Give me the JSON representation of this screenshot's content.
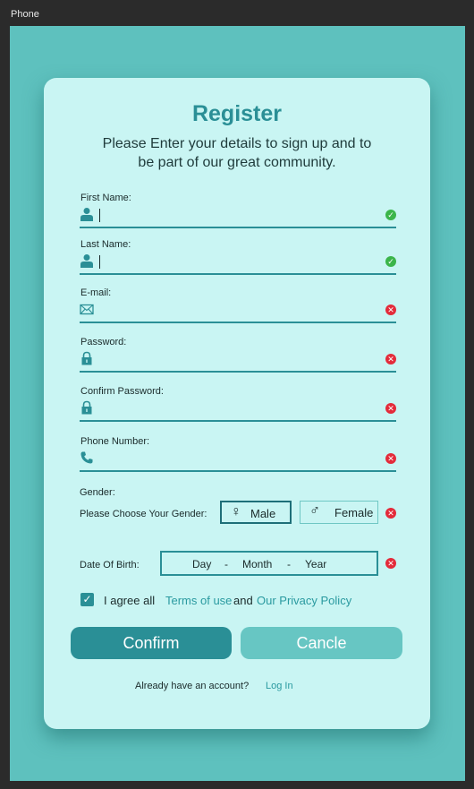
{
  "window": {
    "title": "Phone"
  },
  "colors": {
    "accent": "#2a8f96",
    "background": "#5ec1be",
    "card": "#c9f5f3",
    "valid": "#3bb54a",
    "invalid": "#e32b3a"
  },
  "form": {
    "title": "Register",
    "subtitle": "Please Enter your details to sign up and to be part of our great community.",
    "fields": [
      {
        "label": "First Name:",
        "icon": "user-icon",
        "value": "",
        "status": "valid"
      },
      {
        "label": "Last Name:",
        "icon": "user-icon",
        "value": "",
        "status": "valid"
      },
      {
        "label": "E-mail:",
        "icon": "envelope-icon",
        "value": "",
        "status": "invalid"
      },
      {
        "label": "Password:",
        "icon": "lock-icon",
        "value": "",
        "status": "invalid"
      },
      {
        "label": "Confirm Password:",
        "icon": "lock-icon",
        "value": "",
        "status": "invalid"
      },
      {
        "label": "Phone Number:",
        "icon": "phone-icon",
        "value": "",
        "status": "invalid"
      }
    ],
    "gender": {
      "label": "Gender:",
      "prompt": "Please Choose Your Gender:",
      "male": "Male",
      "female": "Female",
      "status": "invalid"
    },
    "dob": {
      "label": "Date Of Birth:",
      "day": "Day",
      "month": "Month",
      "year": "Year",
      "separator": "-",
      "status": "invalid"
    },
    "agree": {
      "checked": true,
      "prefix": "I agree all",
      "terms": "Terms of use",
      "and": "and",
      "privacy": "Our Privacy Policy"
    },
    "buttons": {
      "confirm": "Confirm",
      "cancel": "Cancle"
    },
    "footer": {
      "question": "Already have an account?",
      "login": "Log In"
    }
  }
}
